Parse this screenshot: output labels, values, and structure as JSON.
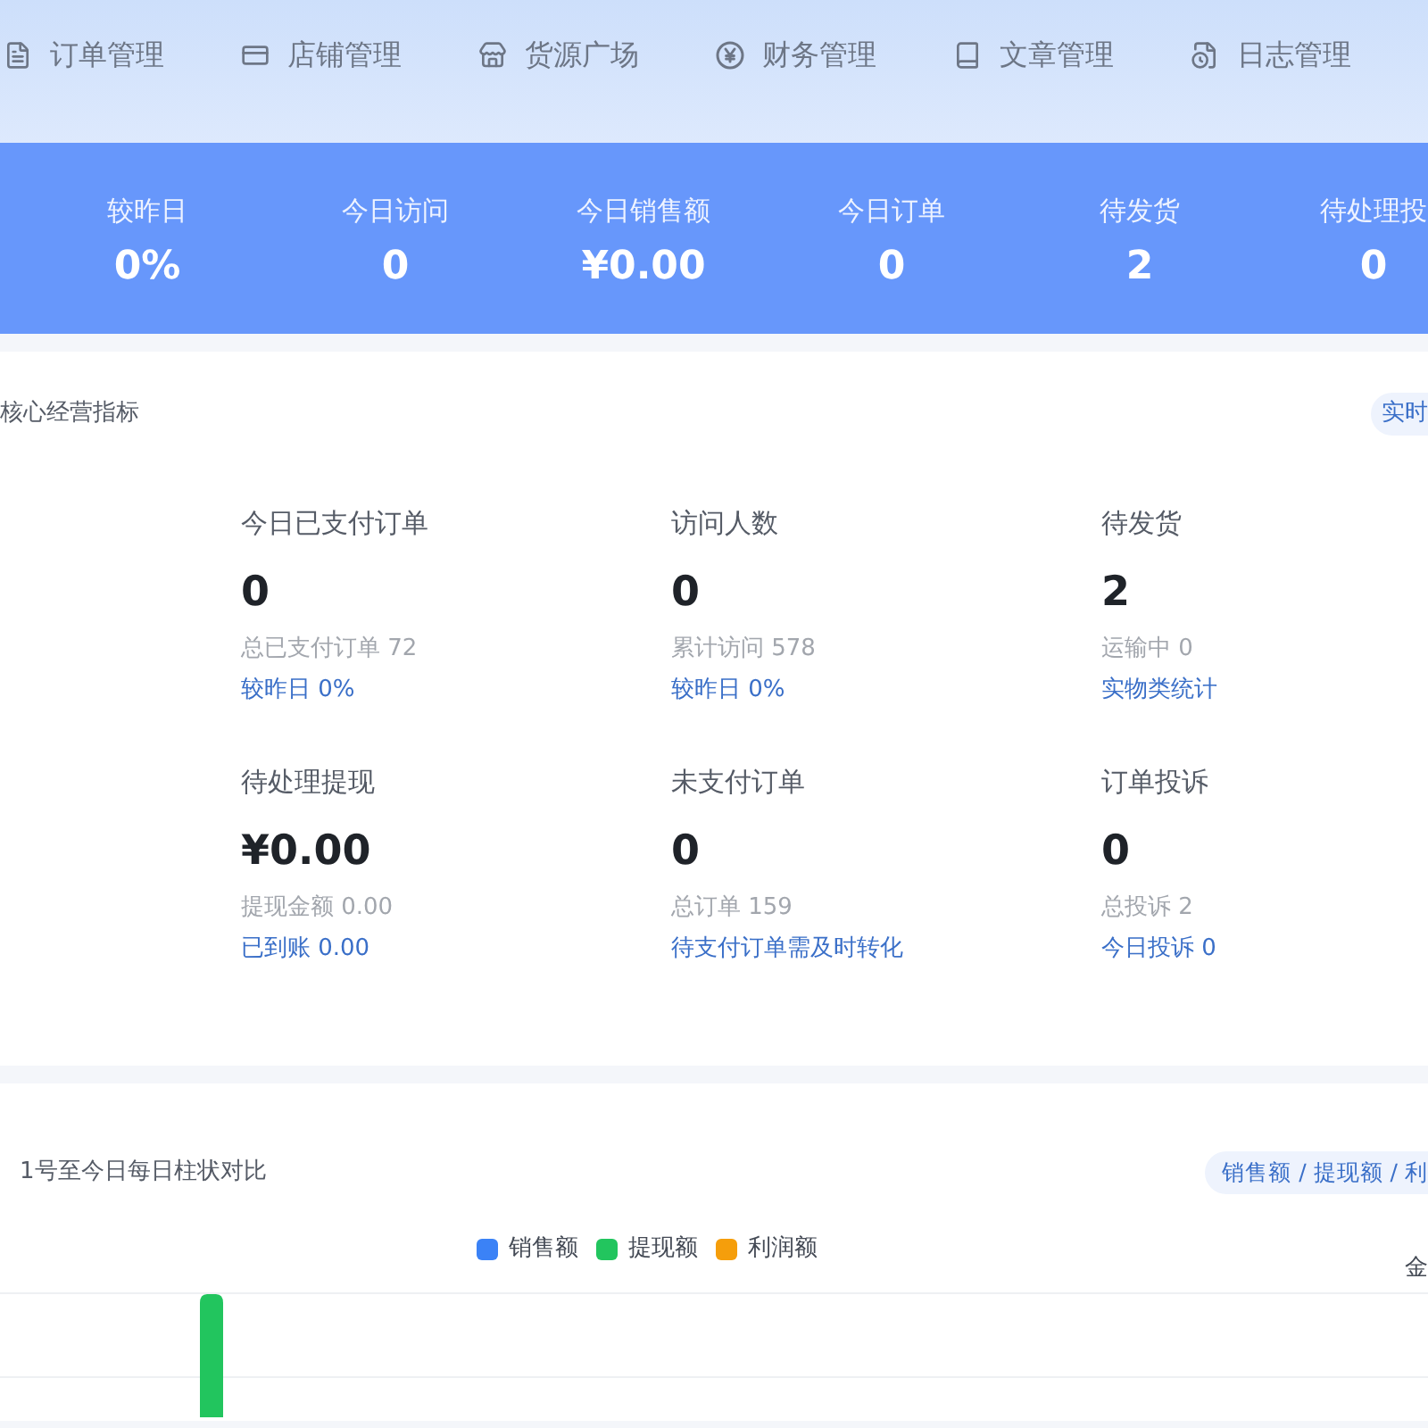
{
  "nav": {
    "items": [
      {
        "label": "订单管理"
      },
      {
        "label": "店铺管理"
      },
      {
        "label": "货源广场"
      },
      {
        "label": "财务管理"
      },
      {
        "label": "文章管理"
      },
      {
        "label": "日志管理"
      }
    ]
  },
  "stats": [
    {
      "label": "较昨日",
      "value": "0%"
    },
    {
      "label": "今日访问",
      "value": "0"
    },
    {
      "label": "今日销售额",
      "value": "¥0.00"
    },
    {
      "label": "今日订单",
      "value": "0"
    },
    {
      "label": "待发货",
      "value": "2"
    },
    {
      "label": "待处理投",
      "value": "0"
    }
  ],
  "overview": {
    "title": "核心经营指标",
    "badge": "实时",
    "metrics": [
      {
        "label": "今日已支付订单",
        "value": "0",
        "sub": "总已支付订单 72",
        "note": "较昨日 0%"
      },
      {
        "label": "访问人数",
        "value": "0",
        "sub": "累计访问 578",
        "note": "较昨日 0%"
      },
      {
        "label": "待发货",
        "value": "2",
        "sub": "运输中 0",
        "note": "实物类统计"
      },
      {
        "label": "待处理提现",
        "value": "¥0.00",
        "sub": "提现金额 0.00",
        "note": "已到账 0.00"
      },
      {
        "label": "未支付订单",
        "value": "0",
        "sub": "总订单 159",
        "note": "待支付订单需及时转化"
      },
      {
        "label": "订单投诉",
        "value": "0",
        "sub": "总投诉 2",
        "note": "今日投诉 0"
      }
    ]
  },
  "chart": {
    "title": "1号至今日每日柱状对比",
    "filter": "销售额 / 提现额 / 利",
    "legend": [
      {
        "label": "销售额",
        "color": "#3b82f6"
      },
      {
        "label": "提现额",
        "color": "#22c55e"
      },
      {
        "label": "利润额",
        "color": "#f59e0b"
      }
    ],
    "axis_label": "金"
  }
}
